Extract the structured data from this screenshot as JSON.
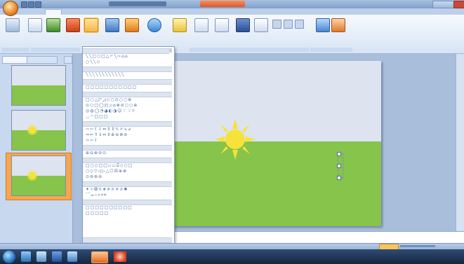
{
  "window": {
    "title": "",
    "context_title": ""
  },
  "ribbon": {
    "tabs": [
      "",
      "",
      "",
      "",
      "",
      "",
      "",
      "",
      ""
    ],
    "active_tab_index": 1
  },
  "left_panel": {
    "tabs": [
      "",
      ""
    ],
    "slide_numbers": [
      "",
      "",
      ""
    ],
    "selected_slide_index": 2
  },
  "shapes_gallery": {
    "sections": [
      {
        "title": "",
        "rows": [
          "╲╲□○□△⌐╲⇨⌂⌂",
          "○╲╲◇"
        ]
      },
      {
        "title": "",
        "rows": [
          "╲╲╲╲╲╲╲╲╲╲╲╲"
        ]
      },
      {
        "title": "",
        "rows": [
          "□□□□□□□□□□□"
        ]
      },
      {
        "title": "",
        "rows": [
          "□○△◸◿◇○⊙○○⊕",
          "⊙○□◯◰▱⌂⊗⊘○○⊕",
          "◎◍◯◔◕◐◑☺♡☽☼",
          "◡◠□□□"
        ]
      },
      {
        "title": "",
        "rows": [
          "⇨⇦⇧⇩⇔⇕⇕⇖⇗⇘⇙",
          "⇒⇐⇑⇓⇔⇕⊕⊖⊗⊘",
          "⇨⇦⇧"
        ]
      },
      {
        "title": "",
        "rows": [
          "⊕⊖⊗⊘⊙"
        ]
      },
      {
        "title": "",
        "rows": [
          "□○◇□□▱▭⌸◇○□",
          "○◇▽◁▷△☐☒⊕⊗",
          "⊙⊚⊛⊜"
        ]
      },
      {
        "title": "",
        "rows": [
          "✦✧✪✫✬✭✮✯✰✱",
          "⌒⌓⌔⌕⌖⌗"
        ]
      },
      {
        "title": "",
        "rows": [
          "□□□□□□□□□□",
          "□□□□□"
        ]
      },
      {
        "title": "",
        "rows": []
      }
    ]
  },
  "status": {
    "left_text": "",
    "right_text": ""
  },
  "taskbar": {
    "tray_text": "",
    "clock": ""
  },
  "colors": {
    "sky": "#dde3ef",
    "grass": "#86c44b",
    "sun": "#f7e23a",
    "ribbon_bg": "#dfe9f6",
    "selected_thumb": "#f5a64f"
  },
  "icons": {
    "app_button": "office-orb-icon",
    "paste": "paste-icon",
    "new_slide": "new-slide-icon",
    "shapes": "shapes-icon",
    "picture": "picture-icon",
    "clip_art": "clip-art-icon",
    "chart": "chart-icon",
    "smartart": "smartart-icon",
    "text_box": "text-box-icon",
    "wordart": "wordart-icon",
    "movie": "movie-icon",
    "sound": "sound-icon"
  }
}
